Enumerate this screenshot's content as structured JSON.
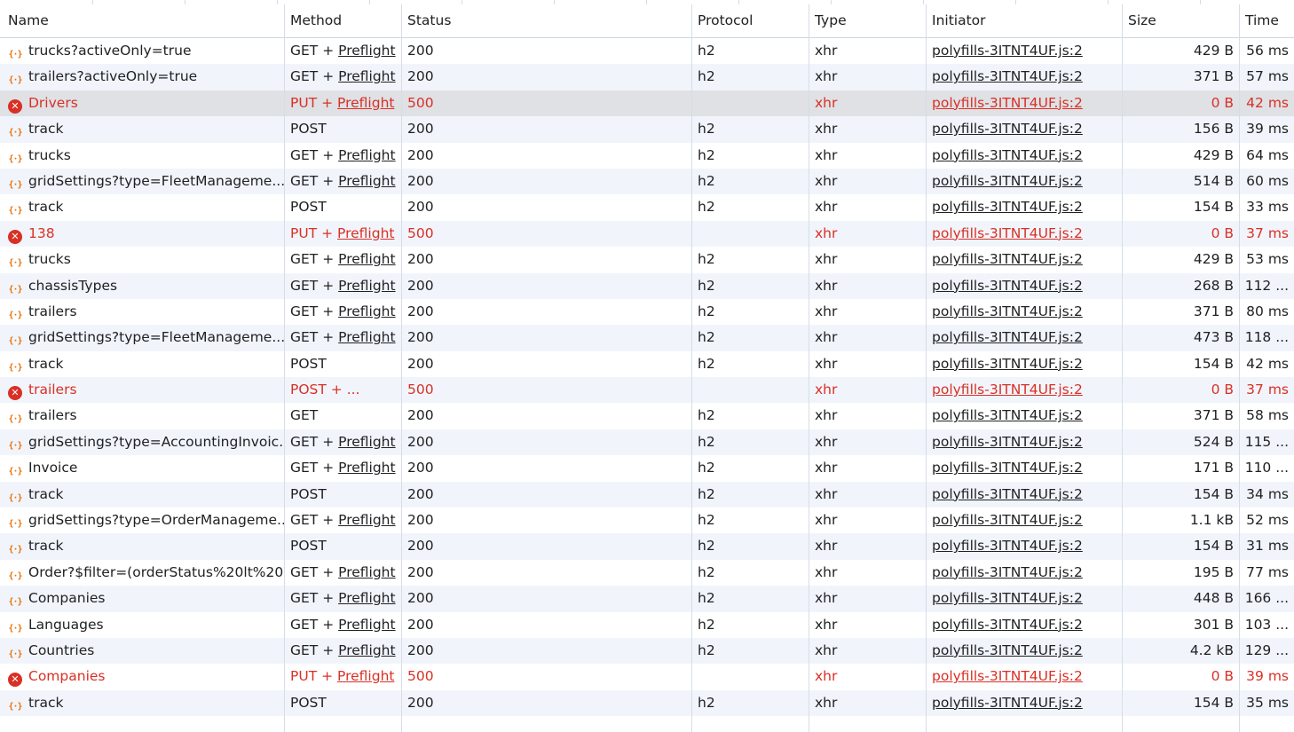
{
  "columns": {
    "name": "Name",
    "method": "Method",
    "status": "Status",
    "protocol": "Protocol",
    "type": "Type",
    "initiator": "Initiator",
    "size": "Size",
    "time": "Time"
  },
  "colors": {
    "error": "#d93025",
    "xhr_icon": "#e8710a",
    "row_alt": "#f1f5fb",
    "row_selected": "#dfe1e5"
  },
  "requests": [
    {
      "name": "trucks?activeOnly=true",
      "method": "GET",
      "sep": " + ",
      "preflight": "Preflight",
      "status": "200",
      "protocol": "h2",
      "type": "xhr",
      "initiator": "polyfills-3ITNT4UF.js:2",
      "size": "429 B",
      "time": "56 ms",
      "error": false,
      "icon": "xhr-icon"
    },
    {
      "name": "trailers?activeOnly=true",
      "method": "GET",
      "sep": " + ",
      "preflight": "Preflight",
      "status": "200",
      "protocol": "h2",
      "type": "xhr",
      "initiator": "polyfills-3ITNT4UF.js:2",
      "size": "371 B",
      "time": "57 ms",
      "error": false,
      "icon": "xhr-icon"
    },
    {
      "name": "Drivers",
      "method": "PUT",
      "sep": " + ",
      "preflight": "Preflight",
      "status": "500",
      "protocol": "",
      "type": "xhr",
      "initiator": "polyfills-3ITNT4UF.js:2",
      "size": "0 B",
      "time": "42 ms",
      "error": true,
      "selected": true,
      "icon": "error-icon"
    },
    {
      "name": "track",
      "method": "POST",
      "sep": "",
      "preflight": "",
      "status": "200",
      "protocol": "h2",
      "type": "xhr",
      "initiator": "polyfills-3ITNT4UF.js:2",
      "size": "156 B",
      "time": "39 ms",
      "error": false,
      "icon": "xhr-icon"
    },
    {
      "name": "trucks",
      "method": "GET",
      "sep": " + ",
      "preflight": "Preflight",
      "status": "200",
      "protocol": "h2",
      "type": "xhr",
      "initiator": "polyfills-3ITNT4UF.js:2",
      "size": "429 B",
      "time": "64 ms",
      "error": false,
      "icon": "xhr-icon"
    },
    {
      "name": "gridSettings?type=FleetManageme...",
      "method": "GET",
      "sep": " + ",
      "preflight": "Preflight",
      "status": "200",
      "protocol": "h2",
      "type": "xhr",
      "initiator": "polyfills-3ITNT4UF.js:2",
      "size": "514 B",
      "time": "60 ms",
      "error": false,
      "icon": "xhr-icon"
    },
    {
      "name": "track",
      "method": "POST",
      "sep": "",
      "preflight": "",
      "status": "200",
      "protocol": "h2",
      "type": "xhr",
      "initiator": "polyfills-3ITNT4UF.js:2",
      "size": "154 B",
      "time": "33 ms",
      "error": false,
      "icon": "xhr-icon"
    },
    {
      "name": "138",
      "method": "PUT",
      "sep": " + ",
      "preflight": "Preflight",
      "status": "500",
      "protocol": "",
      "type": "xhr",
      "initiator": "polyfills-3ITNT4UF.js:2",
      "size": "0 B",
      "time": "37 ms",
      "error": true,
      "icon": "error-icon"
    },
    {
      "name": "trucks",
      "method": "GET",
      "sep": " + ",
      "preflight": "Preflight",
      "status": "200",
      "protocol": "h2",
      "type": "xhr",
      "initiator": "polyfills-3ITNT4UF.js:2",
      "size": "429 B",
      "time": "53 ms",
      "error": false,
      "icon": "xhr-icon"
    },
    {
      "name": "chassisTypes",
      "method": "GET",
      "sep": " + ",
      "preflight": "Preflight",
      "status": "200",
      "protocol": "h2",
      "type": "xhr",
      "initiator": "polyfills-3ITNT4UF.js:2",
      "size": "268 B",
      "time": "112 ...",
      "error": false,
      "icon": "xhr-icon"
    },
    {
      "name": "trailers",
      "method": "GET",
      "sep": " + ",
      "preflight": "Preflight",
      "status": "200",
      "protocol": "h2",
      "type": "xhr",
      "initiator": "polyfills-3ITNT4UF.js:2",
      "size": "371 B",
      "time": "80 ms",
      "error": false,
      "icon": "xhr-icon"
    },
    {
      "name": "gridSettings?type=FleetManageme...",
      "method": "GET",
      "sep": " + ",
      "preflight": "Preflight",
      "status": "200",
      "protocol": "h2",
      "type": "xhr",
      "initiator": "polyfills-3ITNT4UF.js:2",
      "size": "473 B",
      "time": "118 ...",
      "error": false,
      "icon": "xhr-icon"
    },
    {
      "name": "track",
      "method": "POST",
      "sep": "",
      "preflight": "",
      "status": "200",
      "protocol": "h2",
      "type": "xhr",
      "initiator": "polyfills-3ITNT4UF.js:2",
      "size": "154 B",
      "time": "42 ms",
      "error": false,
      "icon": "xhr-icon"
    },
    {
      "name": "trailers",
      "method": "POST",
      "sep": " + ...",
      "preflight": "",
      "status": "500",
      "protocol": "",
      "type": "xhr",
      "initiator": "polyfills-3ITNT4UF.js:2",
      "size": "0 B",
      "time": "37 ms",
      "error": true,
      "icon": "error-icon"
    },
    {
      "name": "trailers",
      "method": "GET",
      "sep": "",
      "preflight": "",
      "status": "200",
      "protocol": "h2",
      "type": "xhr",
      "initiator": "polyfills-3ITNT4UF.js:2",
      "size": "371 B",
      "time": "58 ms",
      "error": false,
      "icon": "xhr-icon"
    },
    {
      "name": "gridSettings?type=AccountingInvoic...",
      "method": "GET",
      "sep": " + ",
      "preflight": "Preflight",
      "status": "200",
      "protocol": "h2",
      "type": "xhr",
      "initiator": "polyfills-3ITNT4UF.js:2",
      "size": "524 B",
      "time": "115 ...",
      "error": false,
      "icon": "xhr-icon"
    },
    {
      "name": "Invoice",
      "method": "GET",
      "sep": " + ",
      "preflight": "Preflight",
      "status": "200",
      "protocol": "h2",
      "type": "xhr",
      "initiator": "polyfills-3ITNT4UF.js:2",
      "size": "171 B",
      "time": "110 ...",
      "error": false,
      "icon": "xhr-icon"
    },
    {
      "name": "track",
      "method": "POST",
      "sep": "",
      "preflight": "",
      "status": "200",
      "protocol": "h2",
      "type": "xhr",
      "initiator": "polyfills-3ITNT4UF.js:2",
      "size": "154 B",
      "time": "34 ms",
      "error": false,
      "icon": "xhr-icon"
    },
    {
      "name": "gridSettings?type=OrderManageme...",
      "method": "GET",
      "sep": " + ",
      "preflight": "Preflight",
      "status": "200",
      "protocol": "h2",
      "type": "xhr",
      "initiator": "polyfills-3ITNT4UF.js:2",
      "size": "1.1 kB",
      "time": "52 ms",
      "error": false,
      "icon": "xhr-icon"
    },
    {
      "name": "track",
      "method": "POST",
      "sep": "",
      "preflight": "",
      "status": "200",
      "protocol": "h2",
      "type": "xhr",
      "initiator": "polyfills-3ITNT4UF.js:2",
      "size": "154 B",
      "time": "31 ms",
      "error": false,
      "icon": "xhr-icon"
    },
    {
      "name": "Order?$filter=(orderStatus%20lt%20...",
      "method": "GET",
      "sep": " + ",
      "preflight": "Preflight",
      "status": "200",
      "protocol": "h2",
      "type": "xhr",
      "initiator": "polyfills-3ITNT4UF.js:2",
      "size": "195 B",
      "time": "77 ms",
      "error": false,
      "icon": "xhr-icon"
    },
    {
      "name": "Companies",
      "method": "GET",
      "sep": " + ",
      "preflight": "Preflight",
      "status": "200",
      "protocol": "h2",
      "type": "xhr",
      "initiator": "polyfills-3ITNT4UF.js:2",
      "size": "448 B",
      "time": "166 ...",
      "error": false,
      "icon": "xhr-icon"
    },
    {
      "name": "Languages",
      "method": "GET",
      "sep": " + ",
      "preflight": "Preflight",
      "status": "200",
      "protocol": "h2",
      "type": "xhr",
      "initiator": "polyfills-3ITNT4UF.js:2",
      "size": "301 B",
      "time": "103 ...",
      "error": false,
      "icon": "xhr-icon"
    },
    {
      "name": "Countries",
      "method": "GET",
      "sep": " + ",
      "preflight": "Preflight",
      "status": "200",
      "protocol": "h2",
      "type": "xhr",
      "initiator": "polyfills-3ITNT4UF.js:2",
      "size": "4.2 kB",
      "time": "129 ...",
      "error": false,
      "icon": "xhr-icon"
    },
    {
      "name": "Companies",
      "method": "PUT",
      "sep": " + ",
      "preflight": "Preflight",
      "status": "500",
      "protocol": "",
      "type": "xhr",
      "initiator": "polyfills-3ITNT4UF.js:2",
      "size": "0 B",
      "time": "39 ms",
      "error": true,
      "icon": "error-icon"
    },
    {
      "name": "track",
      "method": "POST",
      "sep": "",
      "preflight": "",
      "status": "200",
      "protocol": "h2",
      "type": "xhr",
      "initiator": "polyfills-3ITNT4UF.js:2",
      "size": "154 B",
      "time": "35 ms",
      "error": false,
      "icon": "xhr-icon"
    }
  ]
}
